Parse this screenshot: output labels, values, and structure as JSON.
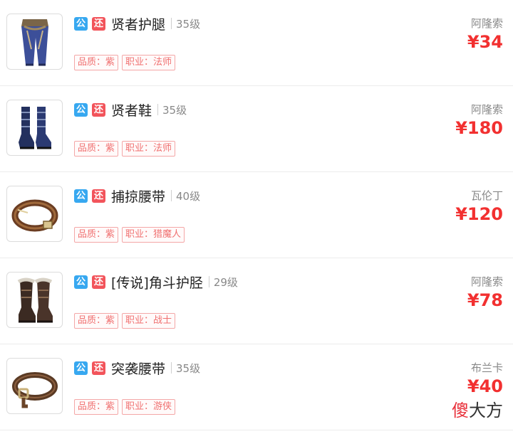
{
  "listings": [
    {
      "badge_public": "公",
      "badge_return": "还",
      "name": "贤者护腿",
      "level": "35级",
      "quality": "品质：紫",
      "profession": "职业：法师",
      "server": "阿隆索",
      "price": "¥34",
      "icon": "leggings-icon"
    },
    {
      "badge_public": "公",
      "badge_return": "还",
      "name": "贤者鞋",
      "level": "35级",
      "quality": "品质：紫",
      "profession": "职业：法师",
      "server": "阿隆索",
      "price": "¥180",
      "icon": "boots-icon"
    },
    {
      "badge_public": "公",
      "badge_return": "还",
      "name": "捕掠腰带",
      "level": "40级",
      "quality": "品质：紫",
      "profession": "职业：猎魔人",
      "server": "瓦伦丁",
      "price": "¥120",
      "icon": "belt-icon"
    },
    {
      "badge_public": "公",
      "badge_return": "还",
      "name": "[传说]角斗护胫",
      "level": "29级",
      "quality": "品质：紫",
      "profession": "职业：战士",
      "server": "阿隆索",
      "price": "¥78",
      "icon": "fur-boots-icon"
    },
    {
      "badge_public": "公",
      "badge_return": "还",
      "name": "突袭腰带",
      "level": "35级",
      "quality": "品质：紫",
      "profession": "职业：游侠",
      "server": "布兰卡",
      "price": "¥40",
      "icon": "buckle-belt-icon"
    }
  ],
  "watermark": {
    "first": "傻",
    "rest": "大方"
  },
  "colors": {
    "price": "#f23030",
    "badge_public": "#37a8f0",
    "badge_return": "#f2545b",
    "tag_border": "#f4a7a7"
  }
}
